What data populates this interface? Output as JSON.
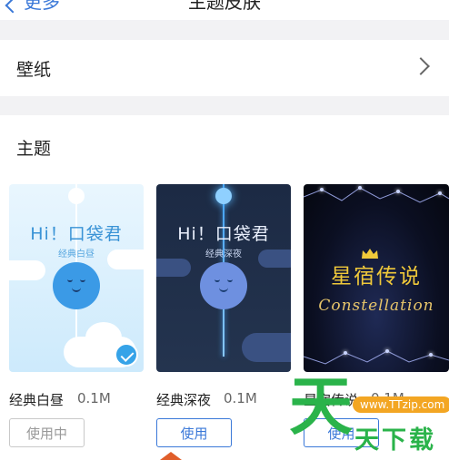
{
  "nav": {
    "back_label": "更多",
    "title": "主题皮肤"
  },
  "wallpaper": {
    "label": "壁纸"
  },
  "themes": {
    "section_title": "主题",
    "items": [
      {
        "card_heading": "Hi！口袋君",
        "card_subtitle": "经典白昼",
        "name": "经典白昼",
        "size": "0.1M",
        "button_label": "使用中",
        "selected": true
      },
      {
        "card_heading": "Hi！口袋君",
        "card_subtitle": "经典深夜",
        "name": "经典深夜",
        "size": "0.1M",
        "button_label": "使用",
        "selected": false
      },
      {
        "card_heading": "星宿传说",
        "card_subtitle": "Constellation",
        "name": "星宿传说",
        "size": "0.1M",
        "button_label": "使用",
        "selected": false
      }
    ]
  },
  "watermark": {
    "big_char": "天",
    "url": "www.TTzip.com",
    "word": "天下载"
  },
  "colors": {
    "accent": "#3a78d8",
    "check": "#36a3e8",
    "watermark_green": "#2ab34a",
    "watermark_orange": "#f3a623"
  }
}
